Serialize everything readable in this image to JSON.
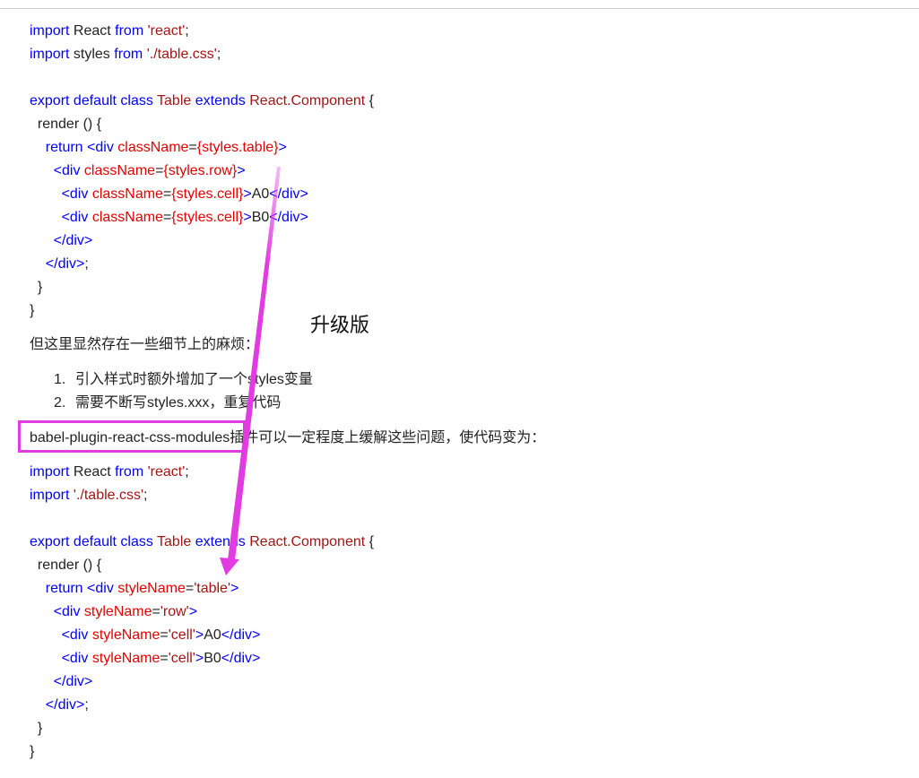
{
  "code_blocks": [
    {
      "lines": [
        [
          [
            "kw",
            "import"
          ],
          [
            "plain",
            " React "
          ],
          [
            "kw",
            "from"
          ],
          [
            "plain",
            " "
          ],
          [
            "str",
            "'react'"
          ],
          [
            "plain",
            ";"
          ]
        ],
        [
          [
            "kw",
            "import"
          ],
          [
            "plain",
            " styles "
          ],
          [
            "kw",
            "from"
          ],
          [
            "plain",
            " "
          ],
          [
            "str",
            "'./table.css'"
          ],
          [
            "plain",
            ";"
          ]
        ],
        [],
        [
          [
            "kw",
            "export"
          ],
          [
            "plain",
            " "
          ],
          [
            "kw",
            "default"
          ],
          [
            "plain",
            " "
          ],
          [
            "kw",
            "class"
          ],
          [
            "plain",
            " "
          ],
          [
            "cls",
            "Table"
          ],
          [
            "plain",
            " "
          ],
          [
            "kw",
            "extends"
          ],
          [
            "plain",
            " "
          ],
          [
            "cls",
            "React.Component"
          ],
          [
            "plain",
            " {"
          ]
        ],
        [
          [
            "plain",
            "  render () {"
          ]
        ],
        [
          [
            "plain",
            "    "
          ],
          [
            "kw",
            "return"
          ],
          [
            "plain",
            " "
          ],
          [
            "tag",
            "<div"
          ],
          [
            "plain",
            " "
          ],
          [
            "attr",
            "className"
          ],
          [
            "plain",
            "="
          ],
          [
            "attr",
            "{styles.table}"
          ],
          [
            "tag",
            ">"
          ]
        ],
        [
          [
            "plain",
            "      "
          ],
          [
            "tag",
            "<div"
          ],
          [
            "plain",
            " "
          ],
          [
            "attr",
            "className"
          ],
          [
            "plain",
            "="
          ],
          [
            "attr",
            "{styles.row}"
          ],
          [
            "tag",
            ">"
          ]
        ],
        [
          [
            "plain",
            "        "
          ],
          [
            "tag",
            "<div"
          ],
          [
            "plain",
            " "
          ],
          [
            "attr",
            "className"
          ],
          [
            "plain",
            "="
          ],
          [
            "attr",
            "{styles.cell}"
          ],
          [
            "tag",
            ">"
          ],
          [
            "plain",
            "A0"
          ],
          [
            "tag",
            "</div>"
          ]
        ],
        [
          [
            "plain",
            "        "
          ],
          [
            "tag",
            "<div"
          ],
          [
            "plain",
            " "
          ],
          [
            "attr",
            "className"
          ],
          [
            "plain",
            "="
          ],
          [
            "attr",
            "{styles.cell}"
          ],
          [
            "tag",
            ">"
          ],
          [
            "plain",
            "B0"
          ],
          [
            "tag",
            "</div>"
          ]
        ],
        [
          [
            "plain",
            "      "
          ],
          [
            "tag",
            "</div>"
          ]
        ],
        [
          [
            "plain",
            "    "
          ],
          [
            "tag",
            "</div>"
          ],
          [
            "plain",
            ";"
          ]
        ],
        [
          [
            "plain",
            "  }"
          ]
        ],
        [
          [
            "plain",
            "}"
          ]
        ]
      ]
    },
    {
      "lines": [
        [
          [
            "kw",
            "import"
          ],
          [
            "plain",
            " React "
          ],
          [
            "kw",
            "from"
          ],
          [
            "plain",
            " "
          ],
          [
            "str",
            "'react'"
          ],
          [
            "plain",
            ";"
          ]
        ],
        [
          [
            "kw",
            "import"
          ],
          [
            "plain",
            " "
          ],
          [
            "str",
            "'./table.css'"
          ],
          [
            "plain",
            ";"
          ]
        ],
        [],
        [
          [
            "kw",
            "export"
          ],
          [
            "plain",
            " "
          ],
          [
            "kw",
            "default"
          ],
          [
            "plain",
            " "
          ],
          [
            "kw",
            "class"
          ],
          [
            "plain",
            " "
          ],
          [
            "cls",
            "Table"
          ],
          [
            "plain",
            " "
          ],
          [
            "kw",
            "extends"
          ],
          [
            "plain",
            " "
          ],
          [
            "cls",
            "React.Component"
          ],
          [
            "plain",
            " {"
          ]
        ],
        [
          [
            "plain",
            "  render () {"
          ]
        ],
        [
          [
            "plain",
            "    "
          ],
          [
            "kw",
            "return"
          ],
          [
            "plain",
            " "
          ],
          [
            "tag",
            "<div"
          ],
          [
            "plain",
            " "
          ],
          [
            "attr",
            "styleName"
          ],
          [
            "plain",
            "="
          ],
          [
            "str",
            "'table'"
          ],
          [
            "tag",
            ">"
          ]
        ],
        [
          [
            "plain",
            "      "
          ],
          [
            "tag",
            "<div"
          ],
          [
            "plain",
            " "
          ],
          [
            "attr",
            "styleName"
          ],
          [
            "plain",
            "="
          ],
          [
            "str",
            "'row'"
          ],
          [
            "tag",
            ">"
          ]
        ],
        [
          [
            "plain",
            "        "
          ],
          [
            "tag",
            "<div"
          ],
          [
            "plain",
            " "
          ],
          [
            "attr",
            "styleName"
          ],
          [
            "plain",
            "="
          ],
          [
            "str",
            "'cell'"
          ],
          [
            "tag",
            ">"
          ],
          [
            "plain",
            "A0"
          ],
          [
            "tag",
            "</div>"
          ]
        ],
        [
          [
            "plain",
            "        "
          ],
          [
            "tag",
            "<div"
          ],
          [
            "plain",
            " "
          ],
          [
            "attr",
            "styleName"
          ],
          [
            "plain",
            "="
          ],
          [
            "str",
            "'cell'"
          ],
          [
            "tag",
            ">"
          ],
          [
            "plain",
            "B0"
          ],
          [
            "tag",
            "</div>"
          ]
        ],
        [
          [
            "plain",
            "      "
          ],
          [
            "tag",
            "</div>"
          ]
        ],
        [
          [
            "plain",
            "    "
          ],
          [
            "tag",
            "</div>"
          ],
          [
            "plain",
            ";"
          ]
        ],
        [
          [
            "plain",
            "  }"
          ]
        ],
        [
          [
            "plain",
            "}"
          ]
        ]
      ]
    }
  ],
  "prose": {
    "paragraph_1": "但这里显然存在一些细节上的麻烦：",
    "list_items": [
      {
        "num": "1.",
        "text": "引入样式时额外增加了一个styles变量"
      },
      {
        "num": "2.",
        "text": "需要不断写styles.xxx，重复代码"
      }
    ],
    "paragraph_2": "babel-plugin-react-css-modules插件可以一定程度上缓解这些问题，使代码变为："
  },
  "annotation": {
    "label": "升级版",
    "color": "#e23be2"
  },
  "colors": {
    "keyword": "#0000ff",
    "string": "#a31515",
    "attribute": "#e50000",
    "text": "#222222",
    "annotation": "#e23be2"
  }
}
